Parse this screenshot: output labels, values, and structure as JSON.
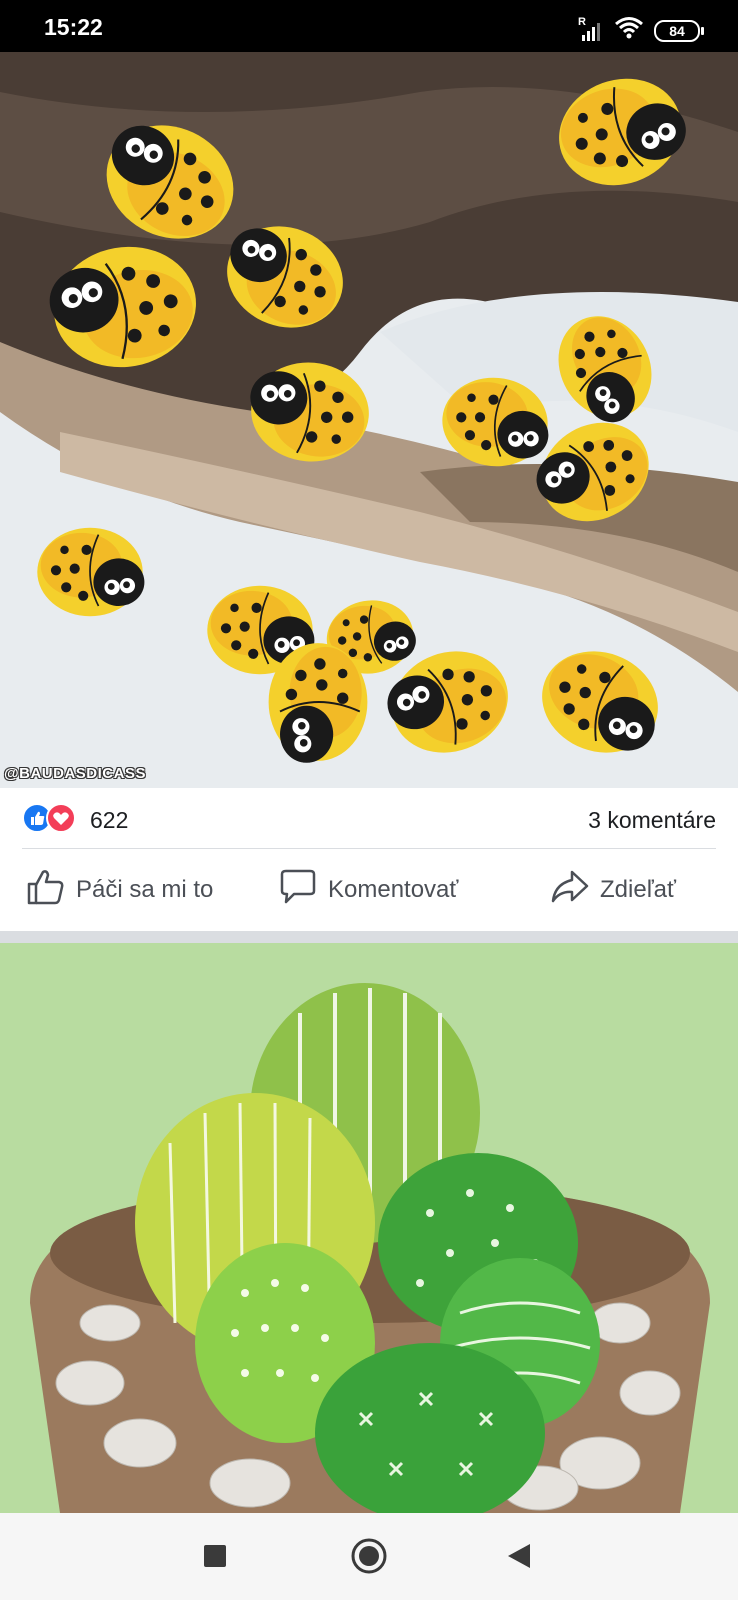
{
  "status_bar": {
    "time": "15:22",
    "signal_label": "R",
    "battery_level": "84"
  },
  "post1": {
    "image_watermark": "@BAUDASDICASS",
    "reaction_count": "622",
    "comment_count": "3 komentáre",
    "actions": {
      "like_label": "Páči sa mi to",
      "comment_label": "Komentovať",
      "share_label": "Zdieľať"
    }
  },
  "icons": {
    "like": "thumbs-up-icon",
    "comment": "speech-bubble-icon",
    "share": "share-arrow-icon",
    "reaction_like": "like-reaction-icon",
    "reaction_love": "love-reaction-icon"
  },
  "colors": {
    "facebook_blue": "#1877f2",
    "love_red": "#f33e58",
    "action_text": "#4b4f56",
    "separator": "#dadde1"
  },
  "nav_bar": {
    "buttons": [
      "recent-apps",
      "home",
      "back"
    ]
  }
}
